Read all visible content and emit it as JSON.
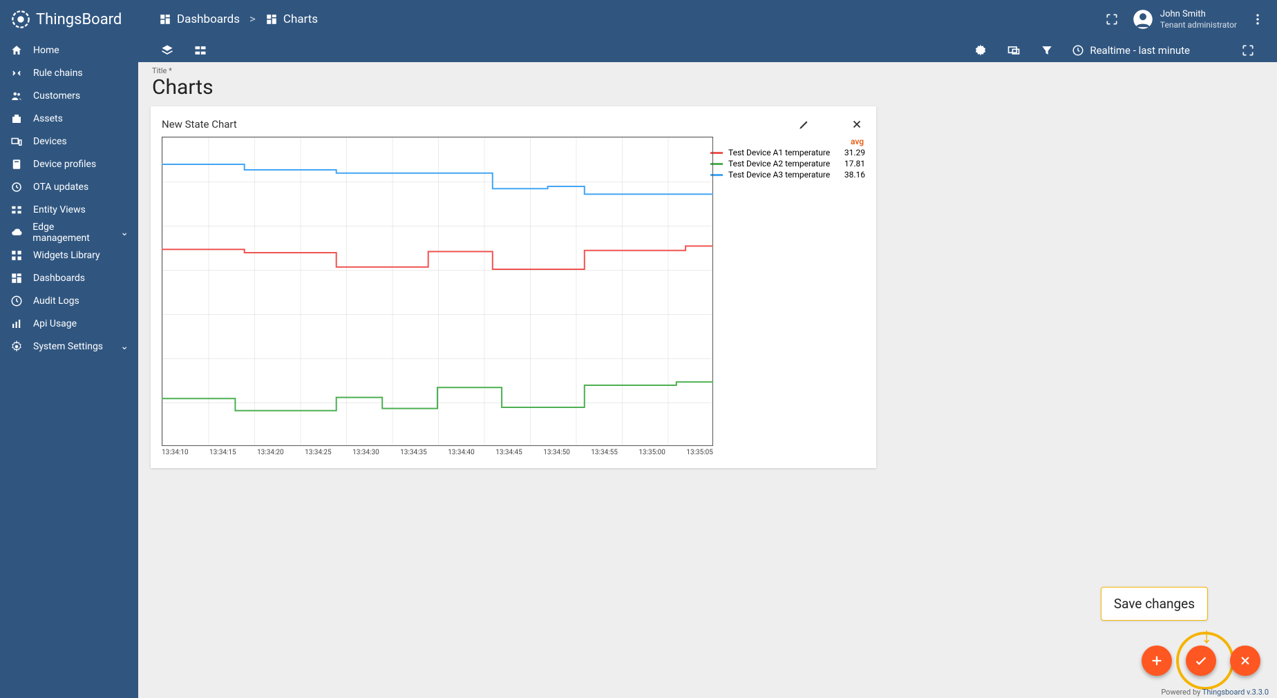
{
  "brand": "ThingsBoard",
  "breadcrumb": {
    "root": "Dashboards",
    "sep": ">",
    "current": "Charts"
  },
  "user": {
    "name": "John Smith",
    "role": "Tenant administrator"
  },
  "sidebar": {
    "items": [
      {
        "label": "Home"
      },
      {
        "label": "Rule chains"
      },
      {
        "label": "Customers"
      },
      {
        "label": "Assets"
      },
      {
        "label": "Devices"
      },
      {
        "label": "Device profiles"
      },
      {
        "label": "OTA updates"
      },
      {
        "label": "Entity Views"
      },
      {
        "label": "Edge management",
        "expandable": true
      },
      {
        "label": "Widgets Library"
      },
      {
        "label": "Dashboards"
      },
      {
        "label": "Audit Logs"
      },
      {
        "label": "Api Usage"
      },
      {
        "label": "System Settings",
        "expandable": true
      }
    ]
  },
  "toolbar": {
    "time_label": "Realtime - last minute"
  },
  "title_area": {
    "hint": "Title *",
    "title": "Charts"
  },
  "widget": {
    "title": "New State Chart"
  },
  "legend": {
    "header": "avg",
    "rows": [
      {
        "color": "#ef5350",
        "label": "Test Device A1 temperature",
        "value": "31.29"
      },
      {
        "color": "#4caf50",
        "label": "Test Device A2 temperature",
        "value": "17.81"
      },
      {
        "color": "#42a5f5",
        "label": "Test Device A3 temperature",
        "value": "38.16"
      }
    ]
  },
  "tooltip": "Save changes",
  "footer": {
    "prefix": "Powered by ",
    "link": "Thingsboard v.3.3.0"
  },
  "chart_data": {
    "type": "line",
    "xlabel": "",
    "ylabel": "",
    "x_ticks": [
      "13:34:10",
      "13:34:15",
      "13:34:20",
      "13:34:25",
      "13:34:30",
      "13:34:35",
      "13:34:40",
      "13:34:45",
      "13:34:50",
      "13:34:55",
      "13:35:00",
      "13:35:05"
    ],
    "ylim": [
      14,
      42
    ],
    "series": [
      {
        "name": "Test Device A1 temperature",
        "color": "#ef5350",
        "x": [
          "13:34:06",
          "13:34:15",
          "13:34:15",
          "13:34:25",
          "13:34:25",
          "13:34:35",
          "13:34:35",
          "13:34:42",
          "13:34:42",
          "13:34:52",
          "13:34:52",
          "13:35:03",
          "13:35:03",
          "13:35:06"
        ],
        "y": [
          31.8,
          31.8,
          31.5,
          31.5,
          30.2,
          30.2,
          31.6,
          31.6,
          30.0,
          30.0,
          31.7,
          31.7,
          32.1,
          32.1
        ]
      },
      {
        "name": "Test Device A2 temperature",
        "color": "#4caf50",
        "x": [
          "13:34:06",
          "13:34:14",
          "13:34:14",
          "13:34:25",
          "13:34:25",
          "13:34:30",
          "13:34:30",
          "13:34:36",
          "13:34:36",
          "13:34:43",
          "13:34:43",
          "13:34:52",
          "13:34:52",
          "13:35:02",
          "13:35:02",
          "13:35:06"
        ],
        "y": [
          18.3,
          18.3,
          17.2,
          17.2,
          18.4,
          18.4,
          17.4,
          17.4,
          19.3,
          19.3,
          17.5,
          17.5,
          19.5,
          19.5,
          19.8,
          19.8
        ]
      },
      {
        "name": "Test Device A3 temperature",
        "color": "#42a5f5",
        "x": [
          "13:34:06",
          "13:34:15",
          "13:34:15",
          "13:34:25",
          "13:34:25",
          "13:34:42",
          "13:34:42",
          "13:34:48",
          "13:34:48",
          "13:34:52",
          "13:34:52",
          "13:35:06"
        ],
        "y": [
          39.5,
          39.5,
          39.0,
          39.0,
          38.7,
          38.7,
          37.3,
          37.3,
          37.5,
          37.5,
          36.8,
          36.8
        ]
      }
    ]
  }
}
